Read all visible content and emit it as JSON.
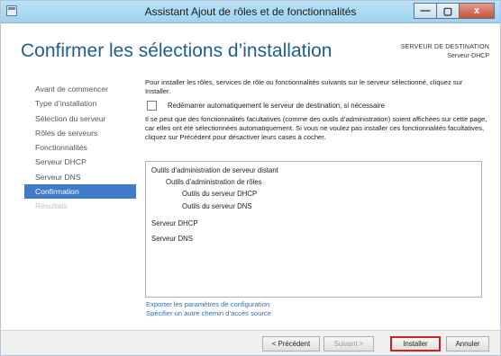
{
  "window": {
    "title": "Assistant Ajout de rôles et de fonctionnalités",
    "minimize_label": "—",
    "maximize_label": "▢",
    "close_label": "x"
  },
  "header": {
    "title": "Confirmer les sélections d’installation",
    "dest_label": "SERVEUR DE DESTINATION",
    "dest_value": "Serveur-DHCP"
  },
  "nav": {
    "items": [
      {
        "label": "Avant de commencer"
      },
      {
        "label": "Type d’installation"
      },
      {
        "label": "Sélection du serveur"
      },
      {
        "label": "Rôles de serveurs"
      },
      {
        "label": "Fonctionnalités"
      },
      {
        "label": "Serveur DHCP"
      },
      {
        "label": "Serveur DNS"
      },
      {
        "label": "Confirmation"
      },
      {
        "label": "Résultats"
      }
    ]
  },
  "main": {
    "intro": "Pour installer les rôles, services de rôle ou fonctionnalités suivants sur le serveur sélectionné, cliquez sur Installer.",
    "restart_label": "Redémarrer automatiquement le serveur de destination, si nécessaire",
    "note": "Il se peut que des fonctionnalités facultatives (comme des outils d’administration) soient affichées sur cette page, car elles ont été sélectionnées automatiquement. Si vous ne voulez pas installer ces fonctionnalités facultatives, cliquez sur Précédent pour désactiver leurs cases à cocher.",
    "selections": [
      "Outils d’administration de serveur distant",
      "Outils d’administration de rôles",
      "Outils du serveur DHCP",
      "Outils du serveur DNS",
      "Serveur DHCP",
      "Serveur DNS"
    ],
    "export_link": "Exporter les paramètres de configuration",
    "source_link": "Spécifier un autre chemin d’accès source"
  },
  "buttons": {
    "previous": "< Précédent",
    "next": "Suivant >",
    "install": "Installer",
    "cancel": "Annuler"
  }
}
